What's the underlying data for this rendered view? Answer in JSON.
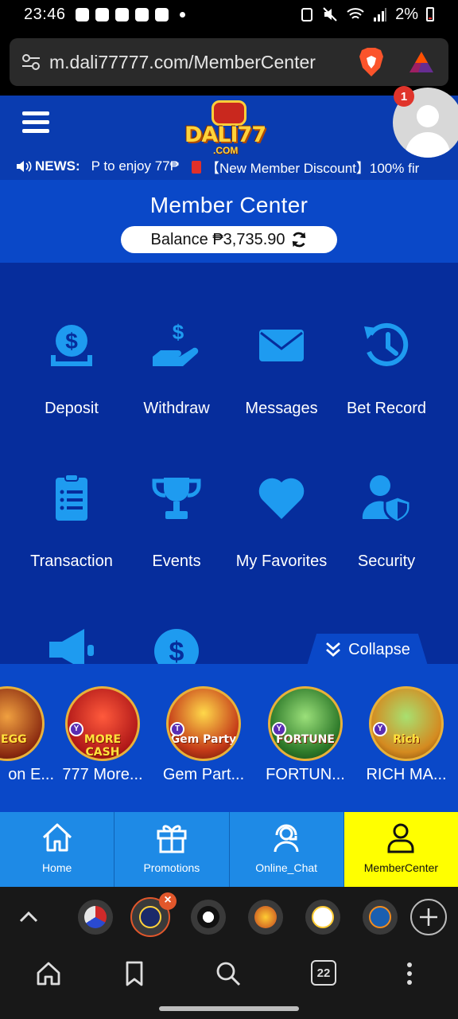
{
  "status": {
    "time": "23:46",
    "battery": "2%"
  },
  "browser": {
    "url": "m.dali77777.com/MemberCenter",
    "tab_count": "22"
  },
  "site": {
    "logo_text": "DALI77",
    "logo_sub": ".COM",
    "notification_count": "1",
    "news_label": "NEWS:",
    "news_text": "P to enjoy 77₱",
    "news_text2": "【New Member Discount】100% fir"
  },
  "member": {
    "title": "Member Center",
    "balance": "Balance ₱3,735.90"
  },
  "actions": [
    {
      "label": "Deposit",
      "icon": "dollar-coin-icon"
    },
    {
      "label": "Withdraw",
      "icon": "hand-money-icon"
    },
    {
      "label": "Messages",
      "icon": "envelope-icon"
    },
    {
      "label": "Bet Record",
      "icon": "history-icon"
    },
    {
      "label": "Transaction",
      "icon": "clipboard-list-icon"
    },
    {
      "label": "Events",
      "icon": "trophy-icon"
    },
    {
      "label": "My Favorites",
      "icon": "heart-icon"
    },
    {
      "label": "Security",
      "icon": "user-shield-icon"
    }
  ],
  "collapse_label": "Collapse",
  "games": [
    {
      "name": "on E...",
      "tag": "N EGG"
    },
    {
      "name": "777 More...",
      "tag": "MORE CASH"
    },
    {
      "name": "Gem Part...",
      "tag": "Gem Party"
    },
    {
      "name": "FORTUN...",
      "tag": "FORTUNE"
    },
    {
      "name": "RICH MA...",
      "tag": "Rich"
    }
  ],
  "nav": [
    {
      "label": "Home",
      "icon": "home-icon"
    },
    {
      "label": "Promotions",
      "icon": "gift-icon"
    },
    {
      "label": "Online_Chat",
      "icon": "headset-icon"
    },
    {
      "label": "MemberCenter",
      "icon": "user-icon"
    }
  ],
  "colors": {
    "header_blue": "#0a3cb0",
    "panel_blue": "#062d9c",
    "icon_blue": "#1e9bf0",
    "nav_blue": "#1e8ae6",
    "active_yellow": "#ffff00"
  }
}
